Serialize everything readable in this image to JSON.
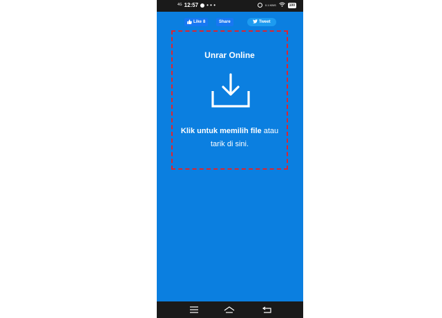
{
  "status_bar": {
    "signal": "4G",
    "time": "12:57",
    "more": "• • •",
    "speed": "0.1 KB/S",
    "battery": "100"
  },
  "social": {
    "like_label": "Like",
    "like_count": "8",
    "share_label": "Share",
    "tweet_label": "Tweet"
  },
  "dropzone": {
    "title": "Unrar Online",
    "instruction_bold": "Klik untuk memilih file",
    "instruction_rest": " atau tarik di sini."
  },
  "colors": {
    "background": "#0b7fe0",
    "facebook": "#1877f2",
    "twitter": "#1d9bf0",
    "dropzone_border": "#e0242c"
  }
}
